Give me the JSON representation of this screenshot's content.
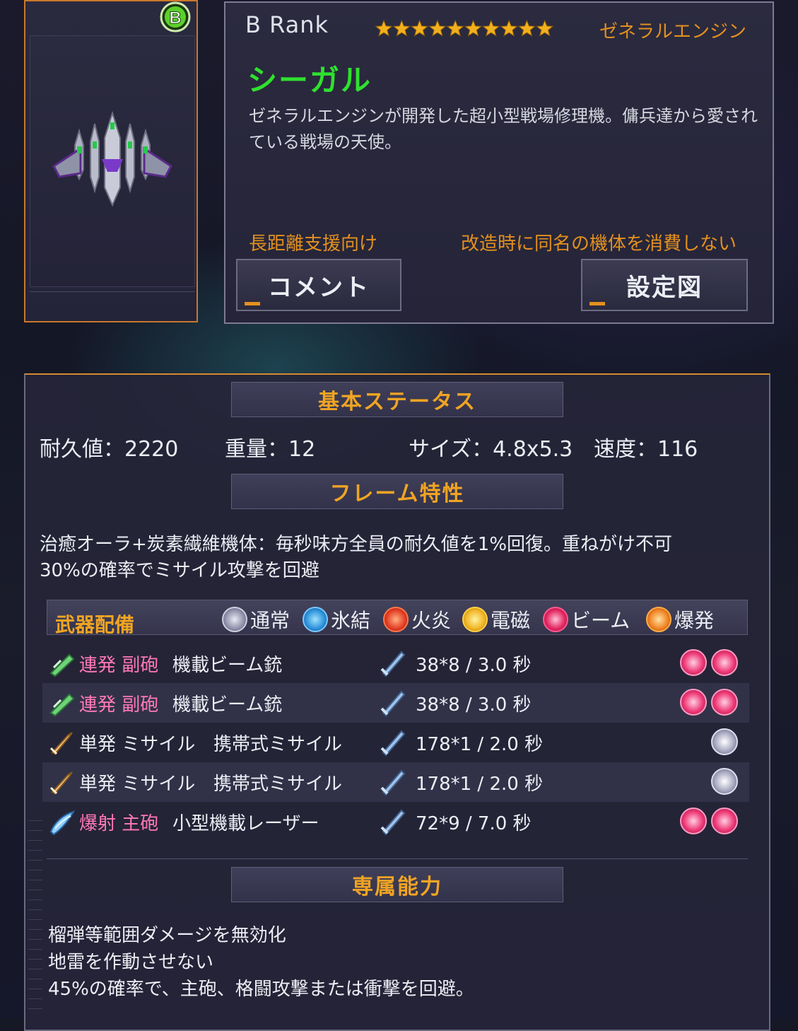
{
  "header": {
    "rank_text": "B  Rank",
    "rank_badge": "B",
    "stars": 10,
    "maker": "ゼネラルエンジン",
    "name": "シーガル",
    "description": "ゼネラルエンジンが開発した超小型戦場修理機。傭兵達から愛されている戦場の天使。",
    "tag_left": "長距離支援向け",
    "tag_right": "改造時に同名の機体を消費しない",
    "comment_button": "コメント",
    "design_button": "設定図"
  },
  "basic_status": {
    "title": "基本ステータス",
    "durability": "耐久値：2220",
    "weight": "重量：12",
    "size": "サイズ：4.8x5.3",
    "speed": "速度：116"
  },
  "frame": {
    "title": "フレーム特性",
    "line1": "治癒オーラ+炭素繊維機体：毎秒味方全員の耐久値を1%回復。重ねがけ不可",
    "line2": "30%の確率でミサイル攻撃を回避"
  },
  "weapons": {
    "title": "武器配備",
    "elements": [
      "通常",
      "氷結",
      "火炎",
      "電磁",
      "ビーム",
      "爆発"
    ],
    "rows": [
      {
        "type": "連発 副砲",
        "name": "機載ビーム銃",
        "damage": "38*8 / 3.0 秒",
        "element": "beam",
        "count": 2
      },
      {
        "type": "連発 副砲",
        "name": "機載ビーム銃",
        "damage": "38*8 / 3.0 秒",
        "element": "beam",
        "count": 2
      },
      {
        "type": "単発 ミサイル",
        "name": "携帯式ミサイル",
        "damage": "178*1 / 2.0 秒",
        "element": "normal",
        "count": 1
      },
      {
        "type": "単発 ミサイル",
        "name": "携帯式ミサイル",
        "damage": "178*1 / 2.0 秒",
        "element": "normal",
        "count": 1
      },
      {
        "type": "爆射 主砲",
        "name": "小型機載レーザー",
        "damage": "72*9 / 7.0 秒",
        "element": "beam",
        "count": 2
      }
    ]
  },
  "ability": {
    "title": "専属能力",
    "line1": "榴弾等範囲ダメージを無効化",
    "line2": "地雷を作動させない",
    "line3": "45%の確率で、主砲、格闘攻撃または衝撃を回避。"
  },
  "colors": {
    "accent_orange": "#e3901f",
    "name_green": "#2fe12f",
    "weapon_type_pink": "#ff79b5"
  }
}
